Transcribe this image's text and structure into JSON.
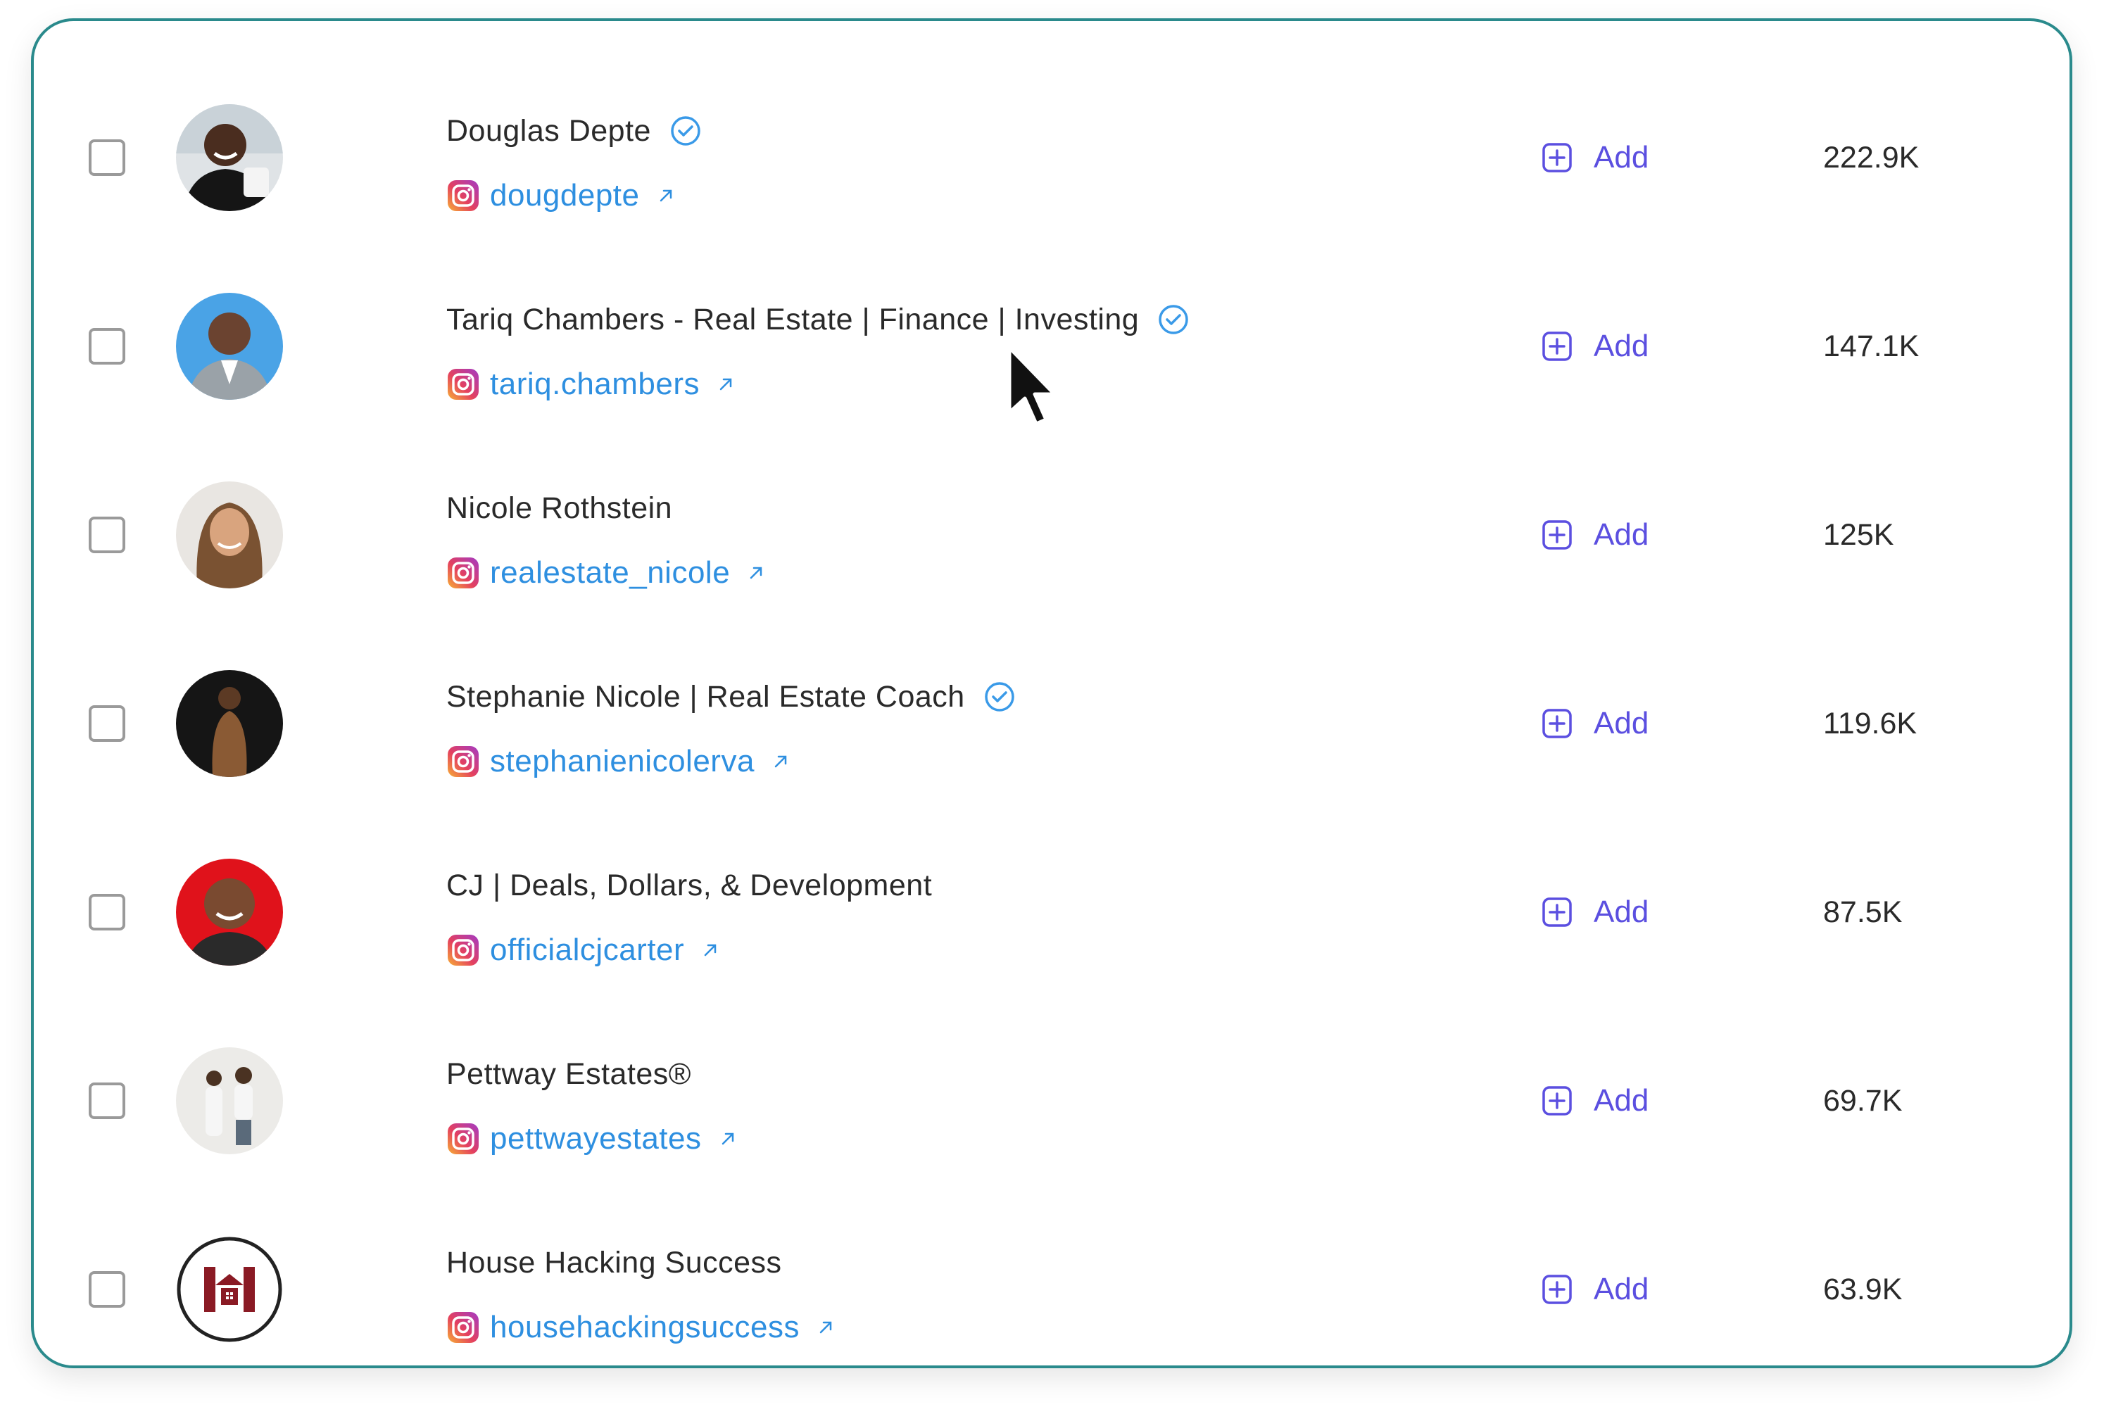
{
  "rows": [
    {
      "name": "Douglas Depte",
      "verified": true,
      "platform_icon": "instagram-icon",
      "handle": "dougdepte",
      "add_label": "Add",
      "followers": "222.9K",
      "avatar": "person-photo"
    },
    {
      "name": "Tariq Chambers - Real Estate | Finance | Investing",
      "verified": true,
      "platform_icon": "instagram-icon",
      "handle": "tariq.chambers",
      "add_label": "Add",
      "followers": "147.1K",
      "avatar": "person-photo"
    },
    {
      "name": "Nicole Rothstein",
      "verified": false,
      "platform_icon": "instagram-icon",
      "handle": "realestate_nicole",
      "add_label": "Add",
      "followers": "125K",
      "avatar": "person-photo"
    },
    {
      "name": "Stephanie Nicole | Real Estate Coach",
      "verified": true,
      "platform_icon": "instagram-icon",
      "handle": "stephanienicolerva",
      "add_label": "Add",
      "followers": "119.6K",
      "avatar": "person-photo"
    },
    {
      "name": "CJ | Deals, Dollars, & Development",
      "verified": false,
      "platform_icon": "instagram-icon",
      "handle": "officialcjcarter",
      "add_label": "Add",
      "followers": "87.5K",
      "avatar": "person-photo"
    },
    {
      "name": "Pettway Estates®",
      "verified": false,
      "platform_icon": "instagram-icon",
      "handle": "pettwayestates",
      "add_label": "Add",
      "followers": "69.7K",
      "avatar": "couple-photo"
    },
    {
      "name": "House Hacking Success",
      "verified": false,
      "platform_icon": "instagram-icon",
      "handle": "househackingsuccess",
      "add_label": "Add",
      "followers": "63.9K",
      "avatar": "house-logo"
    }
  ],
  "colors": {
    "card_border": "#2a8a8c",
    "handle_link": "#2e8fe0",
    "add_accent": "#5b4fe0",
    "verified_badge": "#3a9ae8"
  }
}
